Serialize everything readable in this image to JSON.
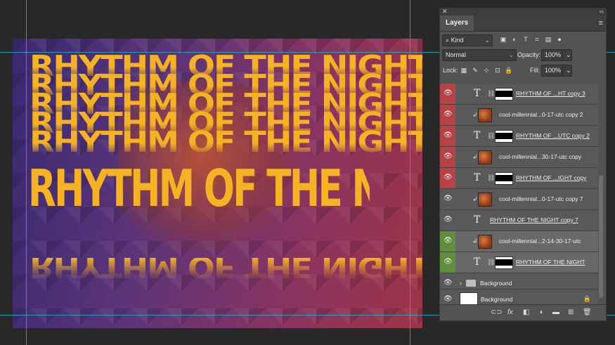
{
  "artwork": {
    "title": "RHYTHM OF THE NIGHT",
    "ghost_lines": [
      "RHYTHM OF THE NIGHT",
      "RHYTHM OF THE NIGHT",
      "RHYTHM OF THE NIGHT",
      "RHYTHM OF THE NIGHT",
      "RHYTHM OF THE NIGHT"
    ],
    "reflection": "RHYTHM OF THE NIGHT",
    "colors": {
      "text": "#f5b324",
      "bg_left": "#3a2a72",
      "bg_right": "#9c3447",
      "guides": "#1fb6cf"
    }
  },
  "panel": {
    "close_glyph": "✕",
    "collapse_glyph": "‹‹",
    "tab": "Layers",
    "menu_glyph": "≡",
    "filter": {
      "value": "Kind",
      "search_glyph": "⌕"
    },
    "filter_icons": [
      "▣",
      "◐",
      "T",
      "⌗",
      "▤",
      "●"
    ],
    "blend_mode": "Normal",
    "opacity_label": "Opacity:",
    "opacity_value": "100%",
    "lock_label": "Lock:",
    "lock_icons": [
      "▦",
      "✎",
      "⊹",
      "⊡",
      "🔒"
    ],
    "fill_label": "Fill:",
    "fill_value": "100%",
    "layers": [
      {
        "kind": "text-mask",
        "name": "RHYTHM OF ...HT copy 3",
        "color": "red",
        "underline": true
      },
      {
        "kind": "image-clip",
        "name": "cool-millennial...0-17-utc copy 2",
        "color": "red",
        "underline": false
      },
      {
        "kind": "text-mask",
        "name": "RHYTHM OF ...UTC copy 2",
        "color": "red",
        "underline": true
      },
      {
        "kind": "image-clip",
        "name": "cool-millennial...30-17-utc copy",
        "color": "red",
        "underline": false
      },
      {
        "kind": "text-mask",
        "name": "RHYTHM OF ...IGHT copy",
        "color": "red",
        "underline": true
      },
      {
        "kind": "image-clip",
        "name": "cool-millennial...0-17-utc copy 7",
        "color": "none",
        "underline": false
      },
      {
        "kind": "text",
        "name": "RHYTHM OF THE NIGHT copy 7",
        "color": "none",
        "underline": true
      },
      {
        "kind": "image-clip",
        "name": "cool-millennial...2-14-30-17-utc",
        "color": "green",
        "underline": false,
        "selected": true
      },
      {
        "kind": "text-mask",
        "name": "RHYTHM OF THE NIGHT",
        "color": "green",
        "underline": true,
        "selected": true
      },
      {
        "kind": "folder",
        "name": "Background",
        "color": "none",
        "underline": false
      },
      {
        "kind": "background",
        "name": "Background",
        "color": "none",
        "underline": false
      }
    ],
    "eye_glyph": "👁",
    "clip_glyph": "↲",
    "link_glyph": "⛓",
    "text_glyph": "T",
    "folder_arrow": "›",
    "lock_glyph": "🔒",
    "bottom_icons": [
      "⊂⊃",
      "fx",
      "◧",
      "◑",
      "▬",
      "⊞",
      "🗑"
    ]
  }
}
